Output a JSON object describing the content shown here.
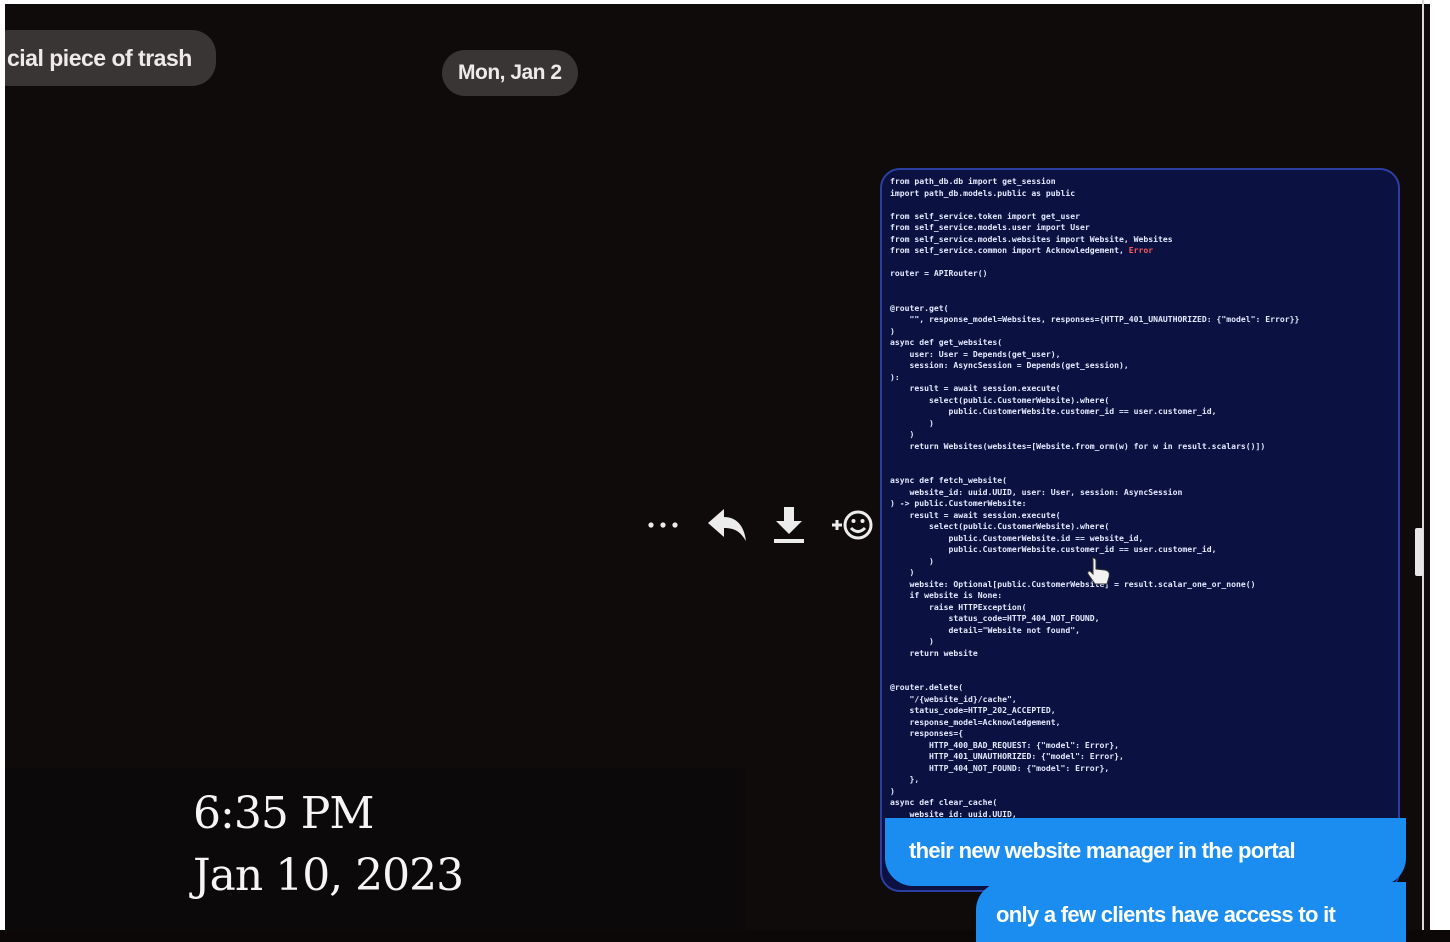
{
  "messages": {
    "previous_snippet": "cial piece of trash",
    "date_separator": "Mon, Jan 2",
    "code_lines": [
      "from path_db.db import get_session",
      "import path_db.models.public as public",
      "",
      "from self_service.token import get_user",
      "from self_service.models.user import User",
      "from self_service.models.websites import Website, Websites",
      "from self_service.common import Acknowledgement, Error",
      "",
      "router = APIRouter()",
      "",
      "",
      "@router.get(",
      "    \"\", response_model=Websites, responses={HTTP_401_UNAUTHORIZED: {\"model\": Error}}",
      ")",
      "async def get_websites(",
      "    user: User = Depends(get_user),",
      "    session: AsyncSession = Depends(get_session),",
      "):",
      "    result = await session.execute(",
      "        select(public.CustomerWebsite).where(",
      "            public.CustomerWebsite.customer_id == user.customer_id,",
      "        )",
      "    )",
      "    return Websites(websites=[Website.from_orm(w) for w in result.scalars()])",
      "",
      "",
      "async def fetch_website(",
      "    website_id: uuid.UUID, user: User, session: AsyncSession",
      ") -> public.CustomerWebsite:",
      "    result = await session.execute(",
      "        select(public.CustomerWebsite).where(",
      "            public.CustomerWebsite.id == website_id,",
      "            public.CustomerWebsite.customer_id == user.customer_id,",
      "        )",
      "    )",
      "    website: Optional[public.CustomerWebsite] = result.scalar_one_or_none()",
      "    if website is None:",
      "        raise HTTPException(",
      "            status_code=HTTP_404_NOT_FOUND,",
      "            detail=\"Website not found\",",
      "        )",
      "    return website",
      "",
      "",
      "@router.delete(",
      "    \"/{website_id}/cache\",",
      "    status_code=HTTP_202_ACCEPTED,",
      "    response_model=Acknowledgement,",
      "    responses={",
      "        HTTP_400_BAD_REQUEST: {\"model\": Error},",
      "        HTTP_401_UNAUTHORIZED: {\"model\": Error},",
      "        HTTP_404_NOT_FOUND: {\"model\": Error},",
      "    },",
      ")",
      "async def clear_cache(",
      "    website_id: uuid.UUID,"
    ],
    "reply_1": "their new website manager in the portal",
    "reply_2": "only a few clients have access to it"
  },
  "actions": {
    "more": "more-icon",
    "reply": "reply-icon",
    "download": "download-icon",
    "react": "add-reaction-icon"
  },
  "timestamp": {
    "time": "6:35 PM",
    "date": "Jan 10, 2023"
  },
  "colors": {
    "background": "#0f0b0b",
    "pill": "#3a3535",
    "code_bubble": "#0b1140",
    "code_border": "#2d3ea2",
    "sent_bubble": "#1b8cf0",
    "error_token": "#ff5a5a"
  }
}
